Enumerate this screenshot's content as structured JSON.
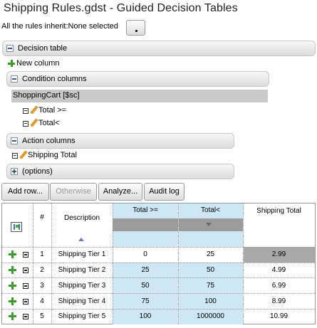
{
  "title": "Shipping Rules.gdst - Guided Decision Tables",
  "inherit": {
    "label": "All the rules inherit:None selected"
  },
  "sections": {
    "decision_table": "Decision table",
    "new_column": "New column",
    "condition_columns": "Condition columns",
    "pattern": "ShoppingCart [$sc]",
    "conditions": [
      "Total >=",
      "Total<"
    ],
    "action_columns": "Action columns",
    "actions": [
      "Shipping Total"
    ],
    "options": "(options)"
  },
  "toolbar": {
    "add_row": "Add row...",
    "otherwise": "Otherwise",
    "analyze": "Analyze...",
    "audit_log": "Audit log"
  },
  "table": {
    "headers": {
      "num": "#",
      "description": "Description",
      "total_gte": "Total >=",
      "total_lt": "Total<",
      "shipping_total": "Shipping Total"
    },
    "rows": [
      {
        "num": "1",
        "description": "Shipping Tier 1",
        "total_gte": "0",
        "total_lt": "25",
        "shipping_total": "2.99"
      },
      {
        "num": "2",
        "description": "Shipping Tier 2",
        "total_gte": "25",
        "total_lt": "50",
        "shipping_total": "4.99"
      },
      {
        "num": "3",
        "description": "Shipping Tier 3",
        "total_gte": "50",
        "total_lt": "75",
        "shipping_total": "6.99"
      },
      {
        "num": "4",
        "description": "Shipping Tier 4",
        "total_gte": "75",
        "total_lt": "100",
        "shipping_total": "8.99"
      },
      {
        "num": "5",
        "description": "Shipping Tier 5",
        "total_gte": "100",
        "total_lt": "1000000",
        "shipping_total": "10.99"
      }
    ]
  },
  "colors": {
    "condition_blue": "#cde7f5",
    "header_bar_gray": "#9b9b9b",
    "selected_cell": "#a9a9a9"
  }
}
